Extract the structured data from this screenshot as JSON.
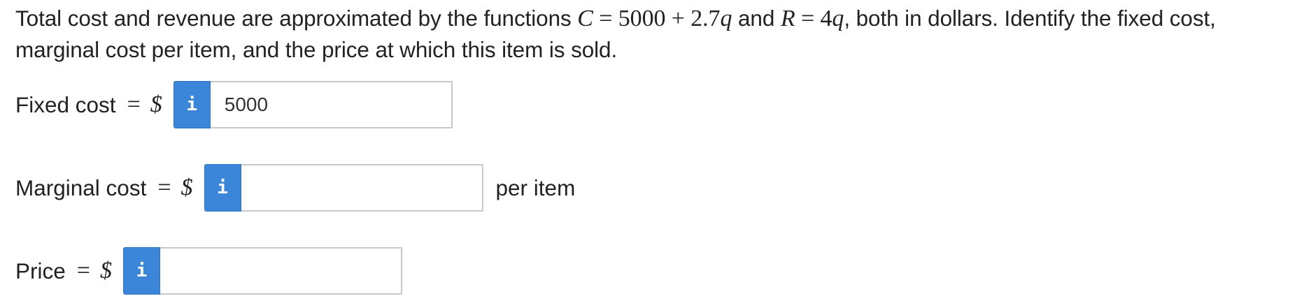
{
  "question": {
    "text_1": "Total cost and revenue are approximated by the functions",
    "C": "C",
    "eq_1": "=",
    "expr_1": "5000 + 2.7",
    "q_1": "q",
    "and": "and",
    "R": "R",
    "eq_2": "=",
    "expr_2": "4",
    "q_2": "q",
    "text_2": ", both in dollars. Identify the fixed cost, marginal cost per item, and the price at which this item is sold."
  },
  "fields": {
    "fixed_cost": {
      "label": "Fixed cost",
      "equals": "=",
      "currency": "$",
      "info_icon": "i",
      "value": "5000"
    },
    "marginal_cost": {
      "label": "Marginal cost",
      "equals": "=",
      "currency": "$",
      "info_icon": "i",
      "value": "",
      "suffix": "per item"
    },
    "price": {
      "label": "Price",
      "equals": "=",
      "currency": "$",
      "info_icon": "i",
      "value": ""
    }
  },
  "colors": {
    "info_button": "#3b86d8",
    "input_border": "#c9c9c9",
    "text": "#222222"
  }
}
